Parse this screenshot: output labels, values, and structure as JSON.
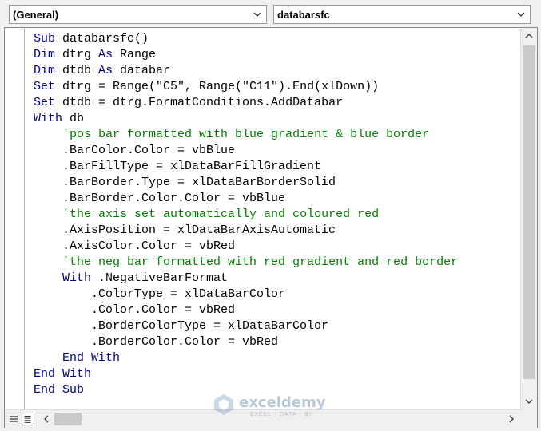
{
  "toolbar": {
    "object_dropdown": "(General)",
    "procedure_dropdown": "databarsfc"
  },
  "code": {
    "lines": [
      [
        {
          "t": "Sub",
          "c": "kw"
        },
        {
          "t": " databarsfc()"
        }
      ],
      [
        {
          "t": "Dim",
          "c": "kw"
        },
        {
          "t": " dtrg "
        },
        {
          "t": "As",
          "c": "kw"
        },
        {
          "t": " Range"
        }
      ],
      [
        {
          "t": "Dim",
          "c": "kw"
        },
        {
          "t": " dtdb "
        },
        {
          "t": "As",
          "c": "kw"
        },
        {
          "t": " databar"
        }
      ],
      [
        {
          "t": "Set",
          "c": "kw"
        },
        {
          "t": " dtrg = Range(\"C5\", Range(\"C11\").End(xlDown))"
        }
      ],
      [
        {
          "t": "Set",
          "c": "kw"
        },
        {
          "t": " dtdb = dtrg.FormatConditions.AddDatabar"
        }
      ],
      [
        {
          "t": "With",
          "c": "kw"
        },
        {
          "t": " db"
        }
      ],
      [
        {
          "t": "    "
        },
        {
          "t": "'pos bar formatted with blue gradient & blue border",
          "c": "cm"
        }
      ],
      [
        {
          "t": "    .BarColor.Color = vbBlue"
        }
      ],
      [
        {
          "t": "    .BarFillType = xlDataBarFillGradient"
        }
      ],
      [
        {
          "t": "    .BarBorder.Type = xlDataBarBorderSolid"
        }
      ],
      [
        {
          "t": "    .BarBorder.Color.Color = vbBlue"
        }
      ],
      [
        {
          "t": "    "
        },
        {
          "t": "'the axis set automatically and coloured red",
          "c": "cm"
        }
      ],
      [
        {
          "t": "    .AxisPosition = xlDataBarAxisAutomatic"
        }
      ],
      [
        {
          "t": "    .AxisColor.Color = vbRed"
        }
      ],
      [
        {
          "t": "    "
        },
        {
          "t": "'the neg bar formatted with red gradient and red border",
          "c": "cm"
        }
      ],
      [
        {
          "t": "    "
        },
        {
          "t": "With",
          "c": "kw"
        },
        {
          "t": " .NegativeBarFormat"
        }
      ],
      [
        {
          "t": "        .ColorType = xlDataBarColor"
        }
      ],
      [
        {
          "t": "        .Color.Color = vbRed"
        }
      ],
      [
        {
          "t": "        .BorderColorType = xlDataBarColor"
        }
      ],
      [
        {
          "t": "        .BorderColor.Color = vbRed"
        }
      ],
      [
        {
          "t": "    "
        },
        {
          "t": "End With",
          "c": "kw"
        }
      ],
      [
        {
          "t": "End With",
          "c": "kw"
        }
      ],
      [
        {
          "t": "End Sub",
          "c": "kw"
        }
      ]
    ]
  },
  "watermark": {
    "name": "exceldemy",
    "tagline": "EXCEL · DATA · BI"
  },
  "colors": {
    "keyword": "#00008b",
    "comment": "#008000",
    "text": "#000000"
  },
  "icons": {
    "dropdown": "chevron-down-icon",
    "scroll_up": "chevron-up-icon",
    "scroll_down": "chevron-down-icon",
    "scroll_left": "chevron-left-icon",
    "scroll_right": "chevron-right-icon",
    "procedure_view": "procedure-view-icon",
    "full_module_view": "full-module-view-icon"
  }
}
